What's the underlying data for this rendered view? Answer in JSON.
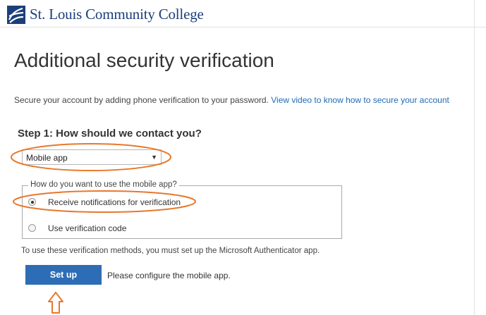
{
  "header": {
    "college_name": "St. Louis Community College",
    "logo_icon": "slcc-logo-icon",
    "brand_color": "#1c3f7a"
  },
  "page": {
    "title": "Additional security verification",
    "intro_text": "Secure your account by adding phone verification to your password.",
    "intro_link": "View video to know how to secure your account"
  },
  "step1": {
    "heading": "Step 1: How should we contact you?",
    "contact_method": {
      "selected": "Mobile app",
      "arrow_icon": "dropdown-arrow-icon"
    },
    "usage_group": {
      "legend": "How do you want to use the mobile app?",
      "options": [
        {
          "label": "Receive notifications for verification",
          "checked": true
        },
        {
          "label": "Use verification code",
          "checked": false
        }
      ]
    },
    "note": "To use these verification methods, you must set up the Microsoft Authenticator app.",
    "setup_button": "Set up",
    "configure_text": "Please configure the mobile app."
  },
  "colors": {
    "accent": "#2d6db5",
    "link": "#1f6bb6",
    "annotation": "#e8782a"
  }
}
